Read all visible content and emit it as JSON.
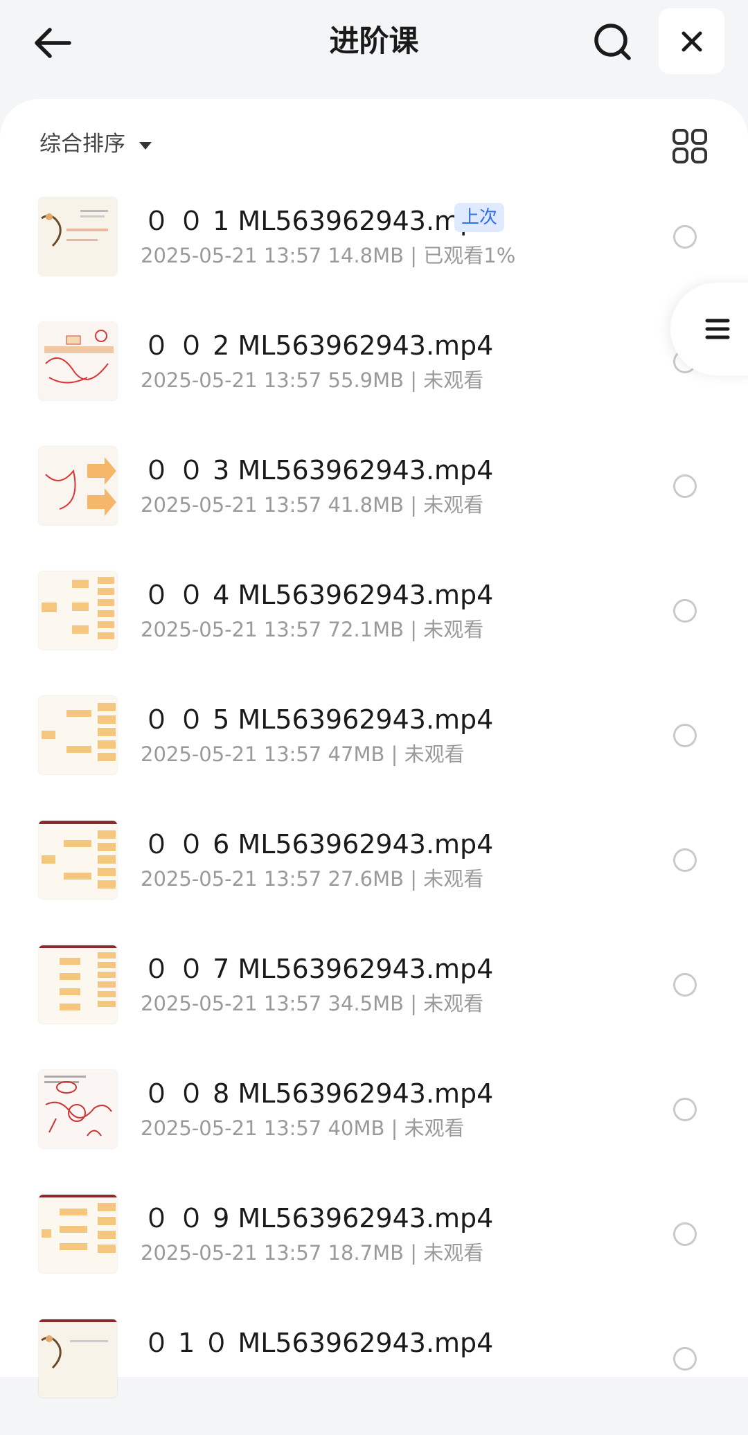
{
  "header": {
    "back_icon": "arrow-left-icon",
    "title": "进阶课",
    "search_icon": "search-icon",
    "close_icon": "close-icon"
  },
  "toolbar": {
    "sort_label": "综合排序",
    "sort_icon": "caret-down-icon",
    "view_icon": "grid-view-icon"
  },
  "floating": {
    "menu_icon": "list-menu-icon"
  },
  "colors": {
    "badge_bg": "#dfe9ff",
    "badge_text": "#2f6ef0",
    "meta_text": "#9a9a9a",
    "thumb_accent": "#f5c77e"
  },
  "files": [
    {
      "name": "０ ０ 1 ML563962943.mp4",
      "meta": "2025-05-21 13:57  14.8MB | 已观看1%",
      "badge": "上次"
    },
    {
      "name": "０ ０ 2 ML563962943.mp4",
      "meta": "2025-05-21 13:57  55.9MB | 未观看"
    },
    {
      "name": "０ ０ 3 ML563962943.mp4",
      "meta": "2025-05-21 13:57  41.8MB | 未观看"
    },
    {
      "name": "０ ０ 4 ML563962943.mp4",
      "meta": "2025-05-21 13:57  72.1MB | 未观看"
    },
    {
      "name": "０ ０ 5 ML563962943.mp4",
      "meta": "2025-05-21 13:57  47MB | 未观看"
    },
    {
      "name": "０ ０ 6 ML563962943.mp4",
      "meta": "2025-05-21 13:57  27.6MB | 未观看"
    },
    {
      "name": "０ ０ 7 ML563962943.mp4",
      "meta": "2025-05-21 13:57  34.5MB | 未观看"
    },
    {
      "name": "０ ０ 8 ML563962943.mp4",
      "meta": "2025-05-21 13:57  40MB | 未观看"
    },
    {
      "name": "０ ０ 9 ML563962943.mp4",
      "meta": "2025-05-21 13:57  18.7MB | 未观看"
    },
    {
      "name": "０ 1 ０ ML563962943.mp4",
      "meta": ""
    }
  ]
}
